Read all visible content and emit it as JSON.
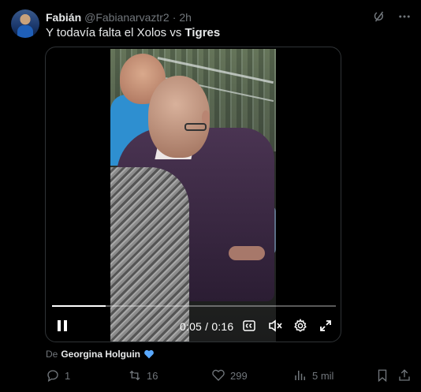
{
  "tweet": {
    "author_name": "Fabián",
    "handle": "@Fabianarvaztr2",
    "separator": "·",
    "time": "2h",
    "text_plain": "Y todavía falta el Xolos vs ",
    "text_bold": "Tigres"
  },
  "video": {
    "timecode": "0:05 / 0:16",
    "progress": 0.19
  },
  "attribution": {
    "prefix": "De",
    "source_name": "Georgina Holguin"
  },
  "actions": {
    "replies": "1",
    "reposts": "16",
    "likes": "299",
    "views": "5 mil"
  },
  "colors": {
    "background": "#000000",
    "text_primary": "#e7e9ea",
    "text_secondary": "#71767b",
    "accent_heart": "#5aa9ff"
  },
  "icons": [
    "grok-icon",
    "more-icon",
    "pause-icon",
    "captions-icon",
    "mute-icon",
    "settings-icon",
    "fullscreen-icon",
    "blue-heart-icon",
    "reply-icon",
    "repost-icon",
    "like-icon",
    "views-icon",
    "bookmark-icon",
    "share-icon"
  ]
}
